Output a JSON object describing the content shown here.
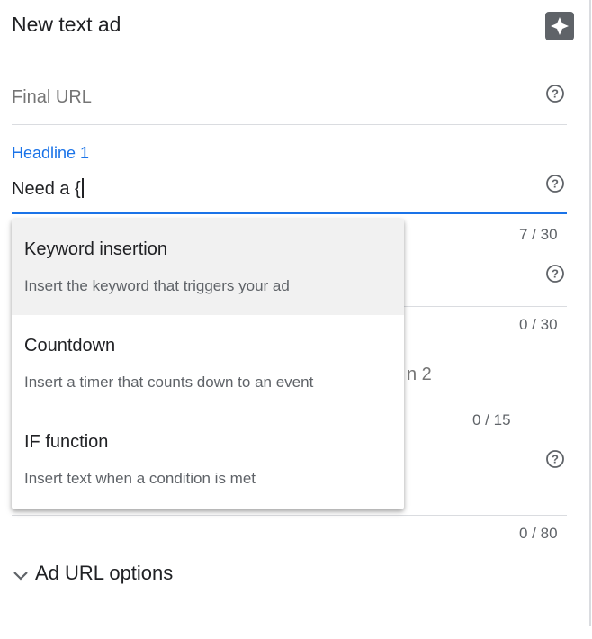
{
  "header": {
    "title": "New text ad",
    "magic_icon": "sparkle-icon"
  },
  "fields": {
    "final_url": {
      "placeholder": "Final URL"
    },
    "headline1": {
      "label": "Headline 1",
      "value": "Need a {",
      "counter": "7 / 30"
    },
    "headline2": {
      "counter": "0 / 30"
    },
    "headline3": {
      "label_fragment": "n 2",
      "counter": "0 / 15"
    },
    "description": {
      "counter": "0 / 80"
    }
  },
  "dropdown": {
    "items": [
      {
        "title": "Keyword insertion",
        "description": "Insert the keyword that triggers your ad"
      },
      {
        "title": "Countdown",
        "description": "Insert a timer that counts down to an event"
      },
      {
        "title": "IF function",
        "description": "Insert text when a condition is met"
      }
    ]
  },
  "url_options": {
    "label": "Ad URL options"
  },
  "colors": {
    "accent": "#1a73e8",
    "highlight": "#f1f1f1",
    "divider": "#dadce0",
    "icon": "#5f6368"
  }
}
